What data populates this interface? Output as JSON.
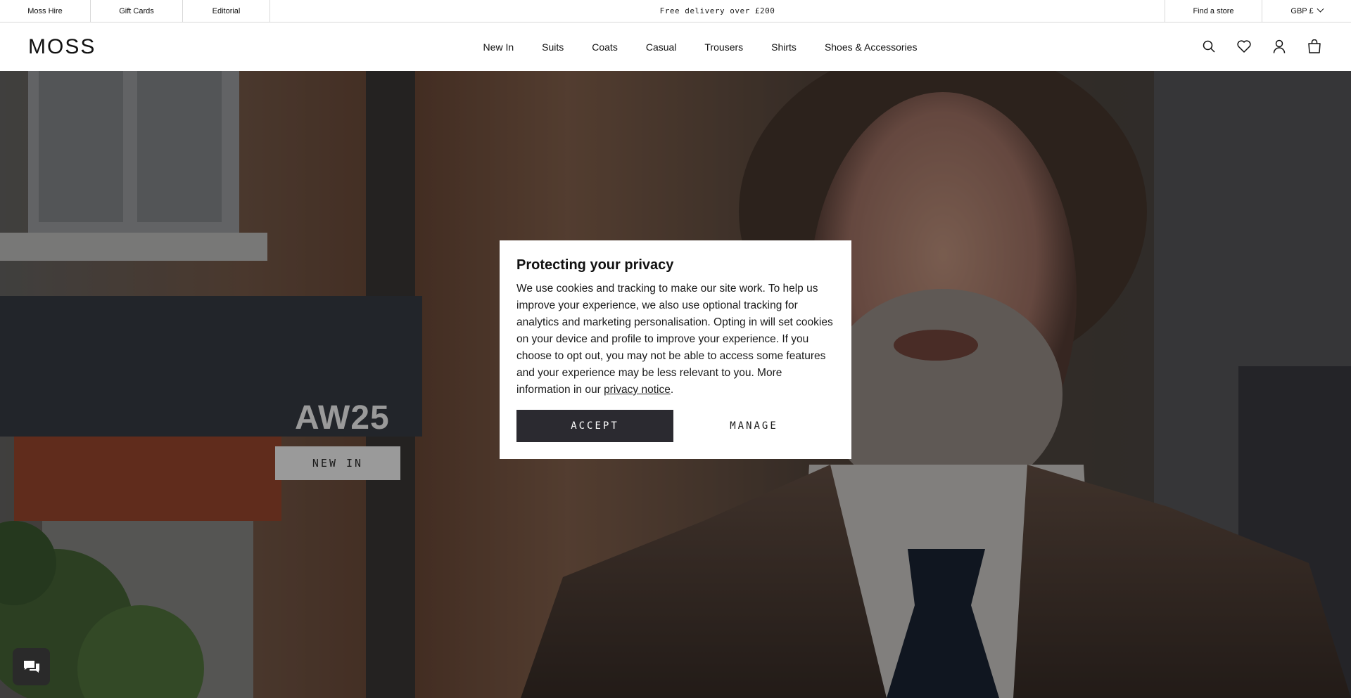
{
  "utility_bar": {
    "left_links": [
      "Moss Hire",
      "Gift Cards",
      "Editorial"
    ],
    "promo": "Free delivery over £200",
    "find_store": "Find a store",
    "currency": "GBP £"
  },
  "header": {
    "logo": "MOSS",
    "nav": [
      "New In",
      "Suits",
      "Coats",
      "Casual",
      "Trousers",
      "Shirts",
      "Shoes & Accessories"
    ],
    "icons": [
      "search-icon",
      "heart-icon",
      "account-icon",
      "bag-icon"
    ]
  },
  "hero": {
    "title": "AW25",
    "cta": "NEW IN"
  },
  "cookie_modal": {
    "title": "Protecting your privacy",
    "body": "We use cookies and tracking to make our site work. To help us improve your experience, we also use optional tracking for analytics and marketing personalisation. Opting in will set cookies on your device and profile to improve your experience. If you choose to opt out, you may not be able to access some features and your experience may be less relevant to you. More information in our ",
    "link": "privacy notice",
    "after_link": ".",
    "accept": "ACCEPT",
    "manage": "MANAGE"
  },
  "colors": {
    "accept_bg": "#2b2a30",
    "hero_button_bg": "#9a9a9a",
    "overlay": "rgba(0,0,0,0.40)"
  }
}
